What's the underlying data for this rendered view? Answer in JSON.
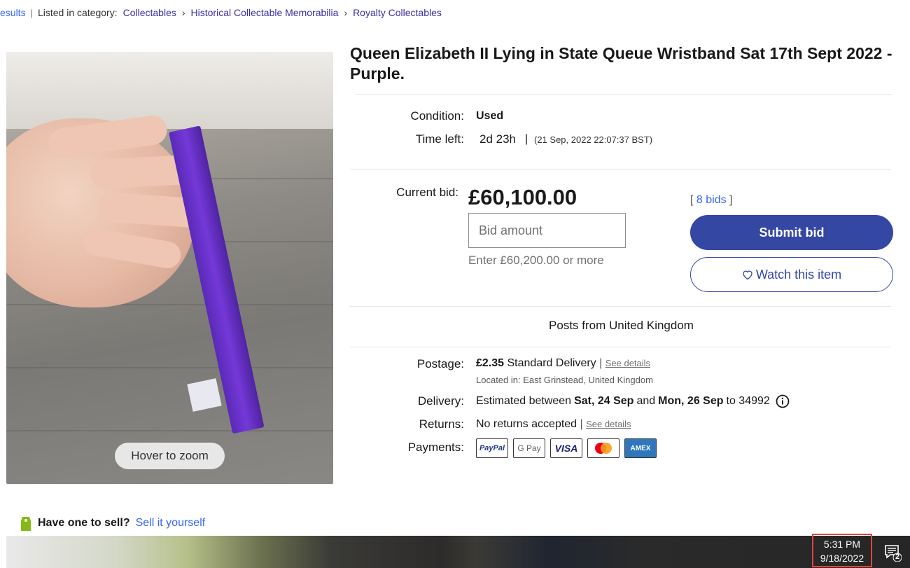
{
  "breadcrumb": {
    "results": "esults",
    "listed_in": "Listed in category:",
    "crumbs": [
      "Collectables",
      "Historical Collectable Memorabilia",
      "Royalty Collectables"
    ]
  },
  "image": {
    "zoom_label": "Hover to zoom"
  },
  "listing": {
    "title": "Queen Elizabeth II Lying in State Queue Wristband Sat 17th Sept 2022 - Purple.",
    "condition_label": "Condition:",
    "condition_value": "Used",
    "time_left_label": "Time left:",
    "time_left_value": "2d 23h",
    "time_left_end": "(21 Sep, 2022  22:07:37 BST)",
    "current_bid_label": "Current bid:",
    "current_bid_value": "£60,100.00",
    "bid_placeholder": "Bid amount",
    "bid_hint": "Enter £60,200.00 or more",
    "bids_link": "8 bids",
    "submit_label": "Submit bid",
    "watch_label": "Watch this item",
    "posts_from": "Posts from United Kingdom"
  },
  "shipping": {
    "postage_label": "Postage:",
    "postage_price": "£2.35",
    "postage_method": "Standard Delivery",
    "see_details": "See details",
    "located_in": "Located in: East Grinstead, United Kingdom",
    "delivery_label": "Delivery:",
    "delivery_prefix": "Estimated between",
    "delivery_start": "Sat, 24 Sep",
    "delivery_and": "and",
    "delivery_end": "Mon, 26 Sep",
    "delivery_to": "to 34992",
    "returns_label": "Returns:",
    "returns_value": "No returns accepted",
    "payments_label": "Payments:",
    "payment_methods": [
      "PayPal",
      "G Pay",
      "VISA",
      "Mastercard",
      "AMEX"
    ]
  },
  "sell": {
    "question": "Have one to sell?",
    "link": "Sell it yourself"
  },
  "taskbar": {
    "time": "5:31 PM",
    "date": "9/18/2022",
    "notifications": "2"
  },
  "colors": {
    "accent": "#3665f3",
    "button": "#3447a3",
    "highlight": "#e0453c"
  }
}
